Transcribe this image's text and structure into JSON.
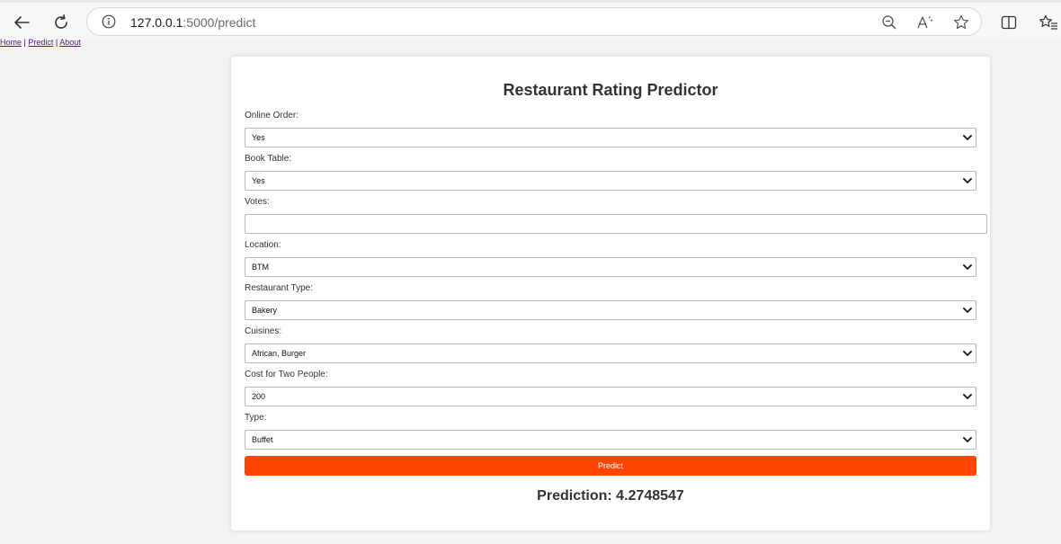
{
  "browser": {
    "url_host": "127.0.0.1",
    "url_path": ":5000/predict"
  },
  "nav": {
    "home": "Home",
    "predict": "Predict",
    "about": "About",
    "separator": "|"
  },
  "form": {
    "title": "Restaurant Rating Predictor",
    "online_order": {
      "label": "Online Order:",
      "value": "Yes"
    },
    "book_table": {
      "label": "Book Table:",
      "value": "Yes"
    },
    "votes": {
      "label": "Votes:",
      "value": ""
    },
    "location": {
      "label": "Location:",
      "value": "BTM"
    },
    "restaurant_type": {
      "label": "Restaurant Type:",
      "value": "Bakery"
    },
    "cuisines": {
      "label": "Cuisines:",
      "value": "African, Burger"
    },
    "cost_for_two": {
      "label": "Cost for Two People:",
      "value": "200"
    },
    "type": {
      "label": "Type:",
      "value": "Buffet"
    },
    "submit_label": "Predict"
  },
  "result": {
    "prediction": "Prediction: 4.2748547"
  },
  "colors": {
    "accent": "#ff4500",
    "link": "#551a8b",
    "page_background": "#f3f3f3"
  },
  "icons": {
    "back": "back-arrow-icon",
    "refresh": "refresh-icon",
    "info": "info-icon",
    "zoom_out": "zoom-out-icon",
    "read_aloud": "read-aloud-icon",
    "favorite": "star-icon",
    "split_screen": "split-screen-icon",
    "favorites_list": "favorites-list-icon",
    "dropdown": "chevron-down-icon"
  }
}
